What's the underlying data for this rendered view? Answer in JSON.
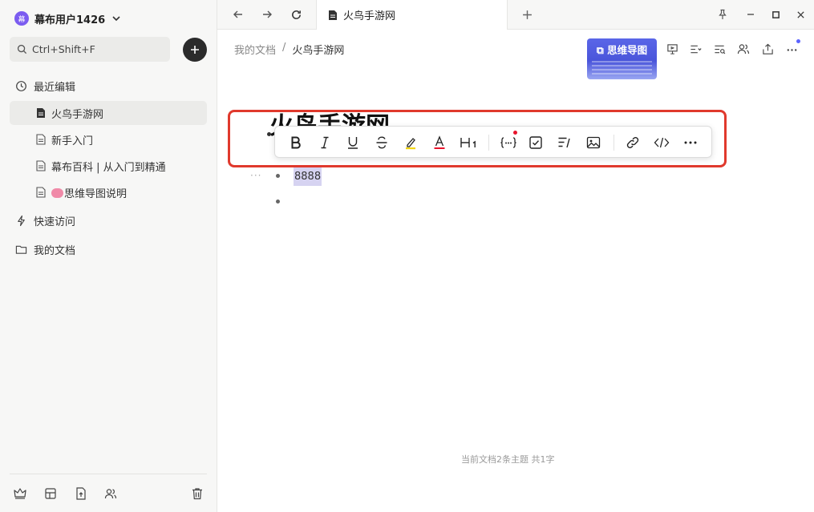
{
  "sidebar": {
    "avatar_text": "幕",
    "user_name": "幕布用户1426",
    "search_placeholder": "Ctrl+Shift+F",
    "recent_label": "最近编辑",
    "docs": [
      {
        "label": "火鸟手游网",
        "active": true
      },
      {
        "label": "新手入门",
        "active": false
      },
      {
        "label": "幕布百科 | 从入门到精通",
        "active": false
      },
      {
        "label": "思维导图说明",
        "active": false
      }
    ],
    "quick_access_label": "快速访问",
    "my_docs_label": "我的文档"
  },
  "tab": {
    "title": "火鸟手游网"
  },
  "breadcrumb": {
    "root": "我的文档",
    "sep": "/",
    "current": "火鸟手游网"
  },
  "mindmap_button": {
    "label": "思维导图"
  },
  "editor": {
    "title": "火鸟手游网",
    "nodes": [
      "8888",
      ""
    ]
  },
  "status": {
    "text": "当前文档2条主题 共1字"
  },
  "colors": {
    "accent": "#7b5cf0",
    "selection": "#d6d3f1",
    "highlight_box": "#e0392d",
    "mindmap_button": "#4a55da"
  }
}
